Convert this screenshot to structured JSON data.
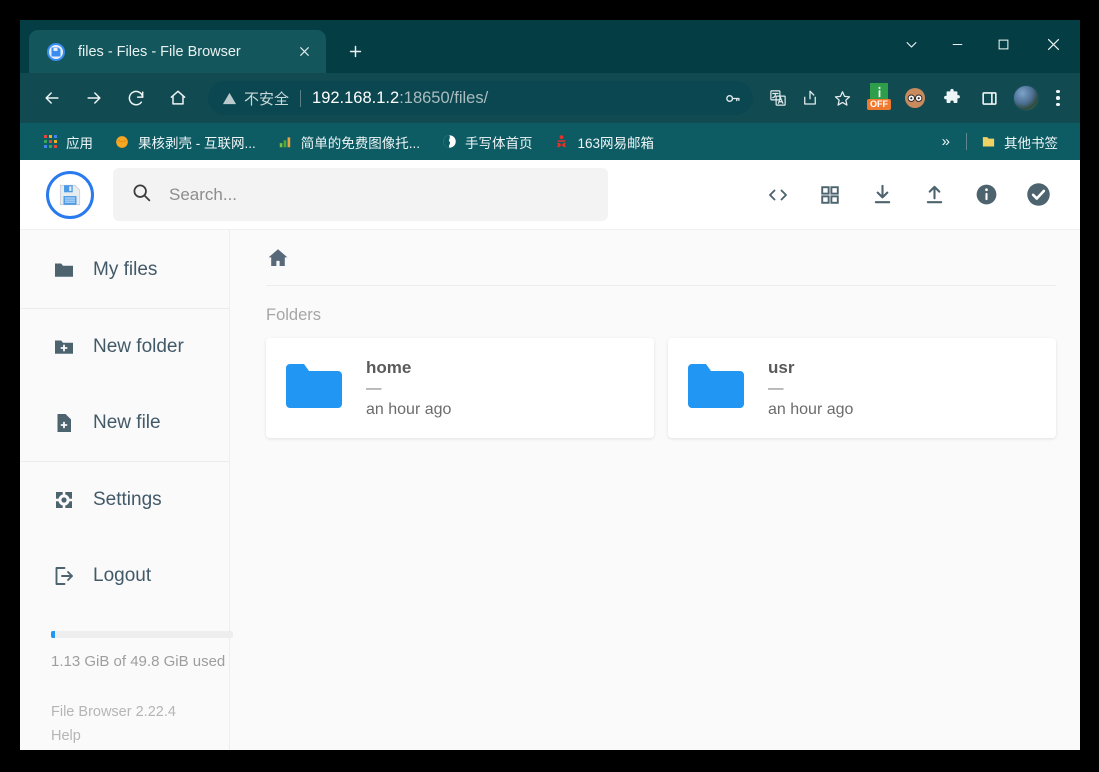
{
  "browser": {
    "tabs": [
      {
        "title": "files - Files - File Browser",
        "favicon": "floppy-disk-icon",
        "close_label": "✕"
      }
    ],
    "new_tab_label": "+",
    "window_controls": {
      "tab_search": "⌄",
      "minimize": "—",
      "maximize": "□",
      "close": "✕"
    },
    "nav": {
      "back": "back-arrow-icon",
      "forward": "forward-arrow-icon",
      "reload": "reload-icon",
      "home": "home-icon"
    },
    "omnibox": {
      "security_text": "不安全",
      "url_host": "192.168.1.2",
      "url_rest": ":18650/files/",
      "full_url": "192.168.1.2:18650/files/",
      "actions": [
        "password-key-icon",
        "translate-icon",
        "share-icon",
        "bookmark-star-icon"
      ]
    },
    "extensions": {
      "adblock_label": "OFF",
      "items": [
        "adblock-extension",
        "glasses-avatar-extension",
        "puzzle-extensions-icon",
        "side-panel-icon",
        "profile-avatar",
        "three-dot-menu"
      ]
    },
    "bookmarks": [
      {
        "label": "应用",
        "icon": "apps-grid-icon"
      },
      {
        "label": "果核剥壳 - 互联网...",
        "icon": "orange-circle-icon"
      },
      {
        "label": "简单的免费图像托...",
        "icon": "bars-chart-icon"
      },
      {
        "label": "手写体首页",
        "icon": "globe-icon"
      },
      {
        "label": "163网易邮箱",
        "icon": "netease-icon"
      }
    ],
    "bookmarks_overflow": "»",
    "other_bookmarks": {
      "label": "其他书签",
      "icon": "folder-icon"
    }
  },
  "app": {
    "logo": "floppy-disk-logo",
    "search": {
      "placeholder": "Search...",
      "value": "",
      "icon": "search-icon"
    },
    "header_actions": [
      {
        "name": "switch-view-code",
        "icon": "code-brackets-icon",
        "label": "<>"
      },
      {
        "name": "switch-view-grid",
        "icon": "grid-view-icon"
      },
      {
        "name": "download",
        "icon": "download-icon"
      },
      {
        "name": "upload",
        "icon": "upload-icon"
      },
      {
        "name": "info",
        "icon": "info-circle-icon"
      },
      {
        "name": "select-multiple",
        "icon": "check-circle-icon"
      }
    ],
    "sidebar": {
      "groups": [
        {
          "items": [
            {
              "label": "My files",
              "icon": "folder-icon"
            }
          ]
        },
        {
          "items": [
            {
              "label": "New folder",
              "icon": "folder-plus-icon"
            },
            {
              "label": "New file",
              "icon": "file-plus-icon"
            }
          ]
        },
        {
          "items": [
            {
              "label": "Settings",
              "icon": "gear-icon"
            },
            {
              "label": "Logout",
              "icon": "logout-icon"
            }
          ]
        }
      ],
      "storage": {
        "used_text": "1.13 GiB of 49.8 GiB used",
        "percent": 2.3,
        "bar_color": "#2196f3"
      },
      "version": "File Browser 2.22.4",
      "help": "Help"
    },
    "main": {
      "breadcrumb": {
        "home_icon": "home-icon",
        "path": "/"
      },
      "folders_heading": "Folders",
      "folders": [
        {
          "name": "home",
          "size": "—",
          "modified": "an hour ago",
          "icon": "folder-icon",
          "color": "#2196f3"
        },
        {
          "name": "usr",
          "size": "—",
          "modified": "an hour ago",
          "icon": "folder-icon",
          "color": "#2196f3"
        }
      ]
    }
  },
  "colors": {
    "browser_tabstrip": "#043d44",
    "browser_toolbar": "#124a51",
    "browser_bookmarks": "#0d5b63",
    "active_tab": "#13565c",
    "accent_blue": "#2196f3",
    "sidebar_text": "#425968",
    "app_bg": "#fafafa"
  }
}
